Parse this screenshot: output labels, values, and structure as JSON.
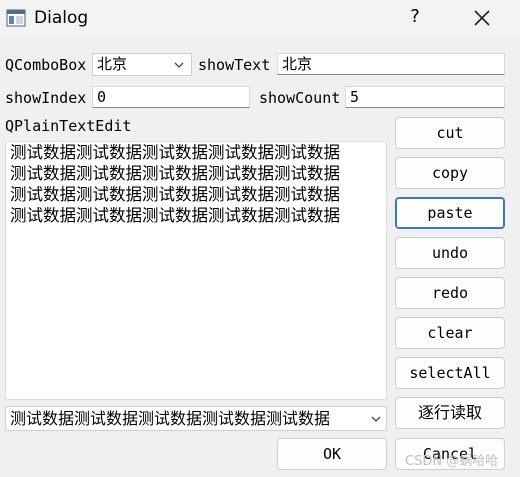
{
  "window": {
    "title": "Dialog",
    "help_label": "?"
  },
  "combo_row": {
    "combo_label": "QComboBox",
    "combo_value": "北京",
    "show_text_label": "showText",
    "show_text_value": "北京"
  },
  "index_row": {
    "show_index_label": "showIndex",
    "show_index_value": "0",
    "show_count_label": "showCount",
    "show_count_value": "5"
  },
  "editor": {
    "label": "QPlainTextEdit",
    "lines": [
      "测试数据测试数据测试数据测试数据测试数据",
      "测试数据测试数据测试数据测试数据测试数据",
      "测试数据测试数据测试数据测试数据测试数据",
      "测试数据测试数据测试数据测试数据测试数据"
    ]
  },
  "bottom_combo": {
    "value": "测试数据测试数据测试数据测试数据测试数据"
  },
  "buttons": {
    "cut": "cut",
    "copy": "copy",
    "paste": "paste",
    "undo": "undo",
    "redo": "redo",
    "clear": "clear",
    "select_all": "selectAll",
    "read_lines": "逐行读取",
    "cancel": "Cancel",
    "ok": "OK"
  },
  "watermark": "CSDN @蜗哈哈",
  "icons": {
    "app": "window-app-icon",
    "close": "close-icon",
    "dropdown": "chevron-down-icon"
  }
}
